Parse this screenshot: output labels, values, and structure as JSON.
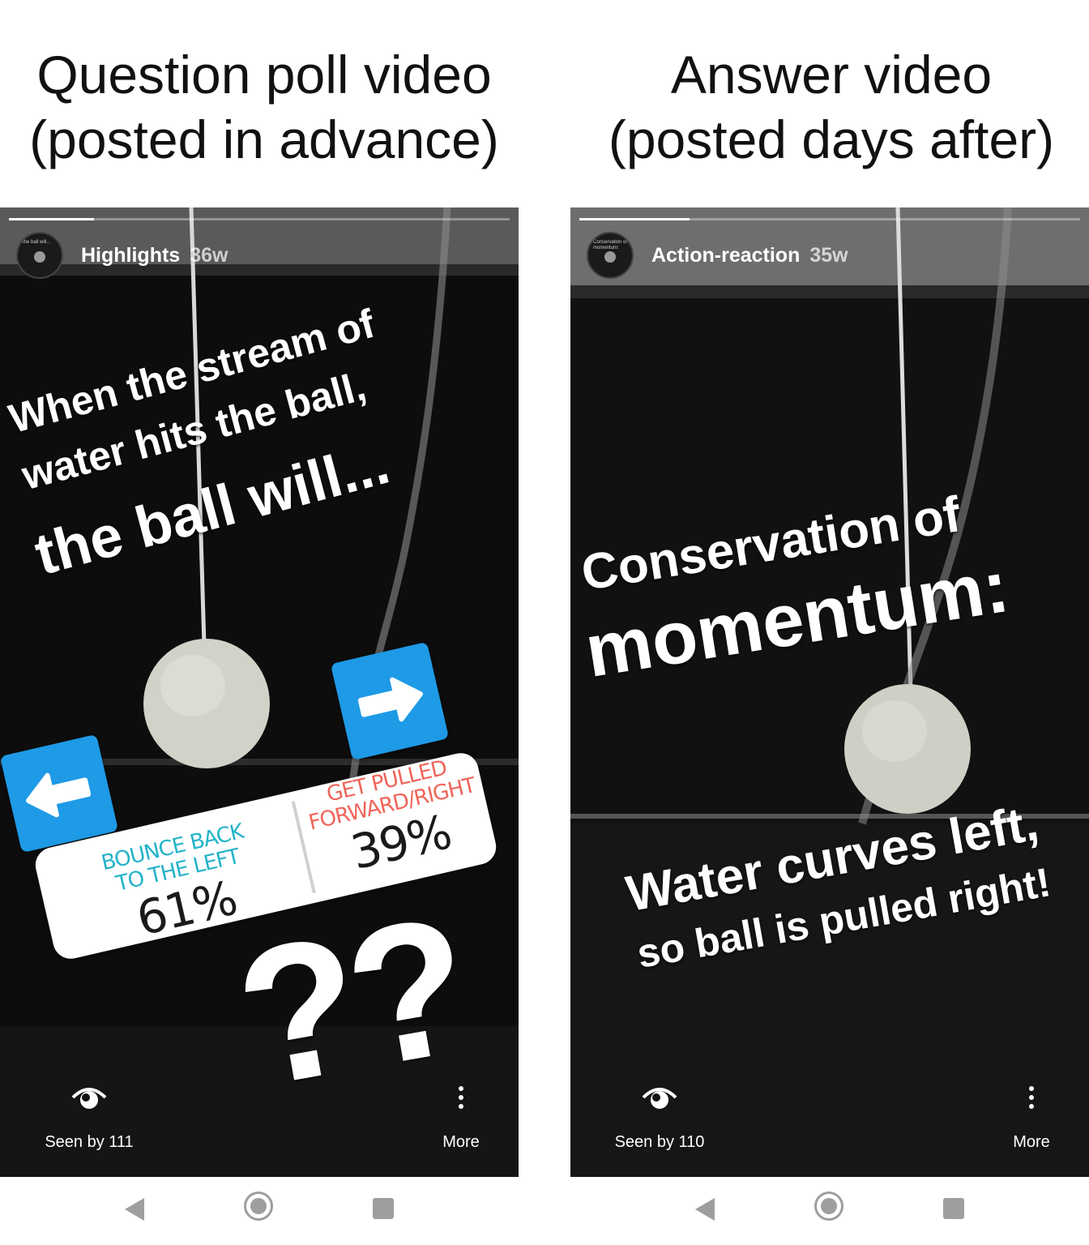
{
  "captions": {
    "left": {
      "line1": "Question poll video",
      "line2": "(posted in advance)"
    },
    "right": {
      "line1": "Answer video",
      "line2": "(posted days after)"
    }
  },
  "left_story": {
    "progress": 0.17,
    "avatar_text": "the ball will...",
    "username": "Highlights",
    "age": "36w",
    "question_line1": "When the stream of",
    "question_line2": "water hits the ball,",
    "question_line3": "the ball will...",
    "poll": {
      "option1_line1": "BOUNCE BACK",
      "option1_line2": "TO THE LEFT",
      "option1_percent": "61%",
      "option2_line1": "GET PULLED",
      "option2_line2": "FORWARD/RIGHT",
      "option2_percent": "39%",
      "option1_color": "#22b3c9",
      "option2_color": "#f0645a"
    },
    "question_marks": "??",
    "seen_by": "Seen by 111",
    "more": "More"
  },
  "right_story": {
    "progress": 0.22,
    "avatar_text": "Conservation of momentum:",
    "username": "Action-reaction",
    "age": "35w",
    "headline_line1": "Conservation of",
    "headline_line2": "momentum:",
    "answer_line1": "Water curves left,",
    "answer_line2": "so ball is pulled right!",
    "seen_by": "Seen by 110",
    "more": "More"
  },
  "icons": [
    "eye-icon",
    "more-vert-icon",
    "back-icon",
    "home-icon",
    "recents-icon",
    "arrow-left-icon",
    "arrow-right-icon"
  ],
  "colors": {
    "sticker_blue": "#1e9ae6",
    "nav_gray": "#9e9e9e"
  }
}
